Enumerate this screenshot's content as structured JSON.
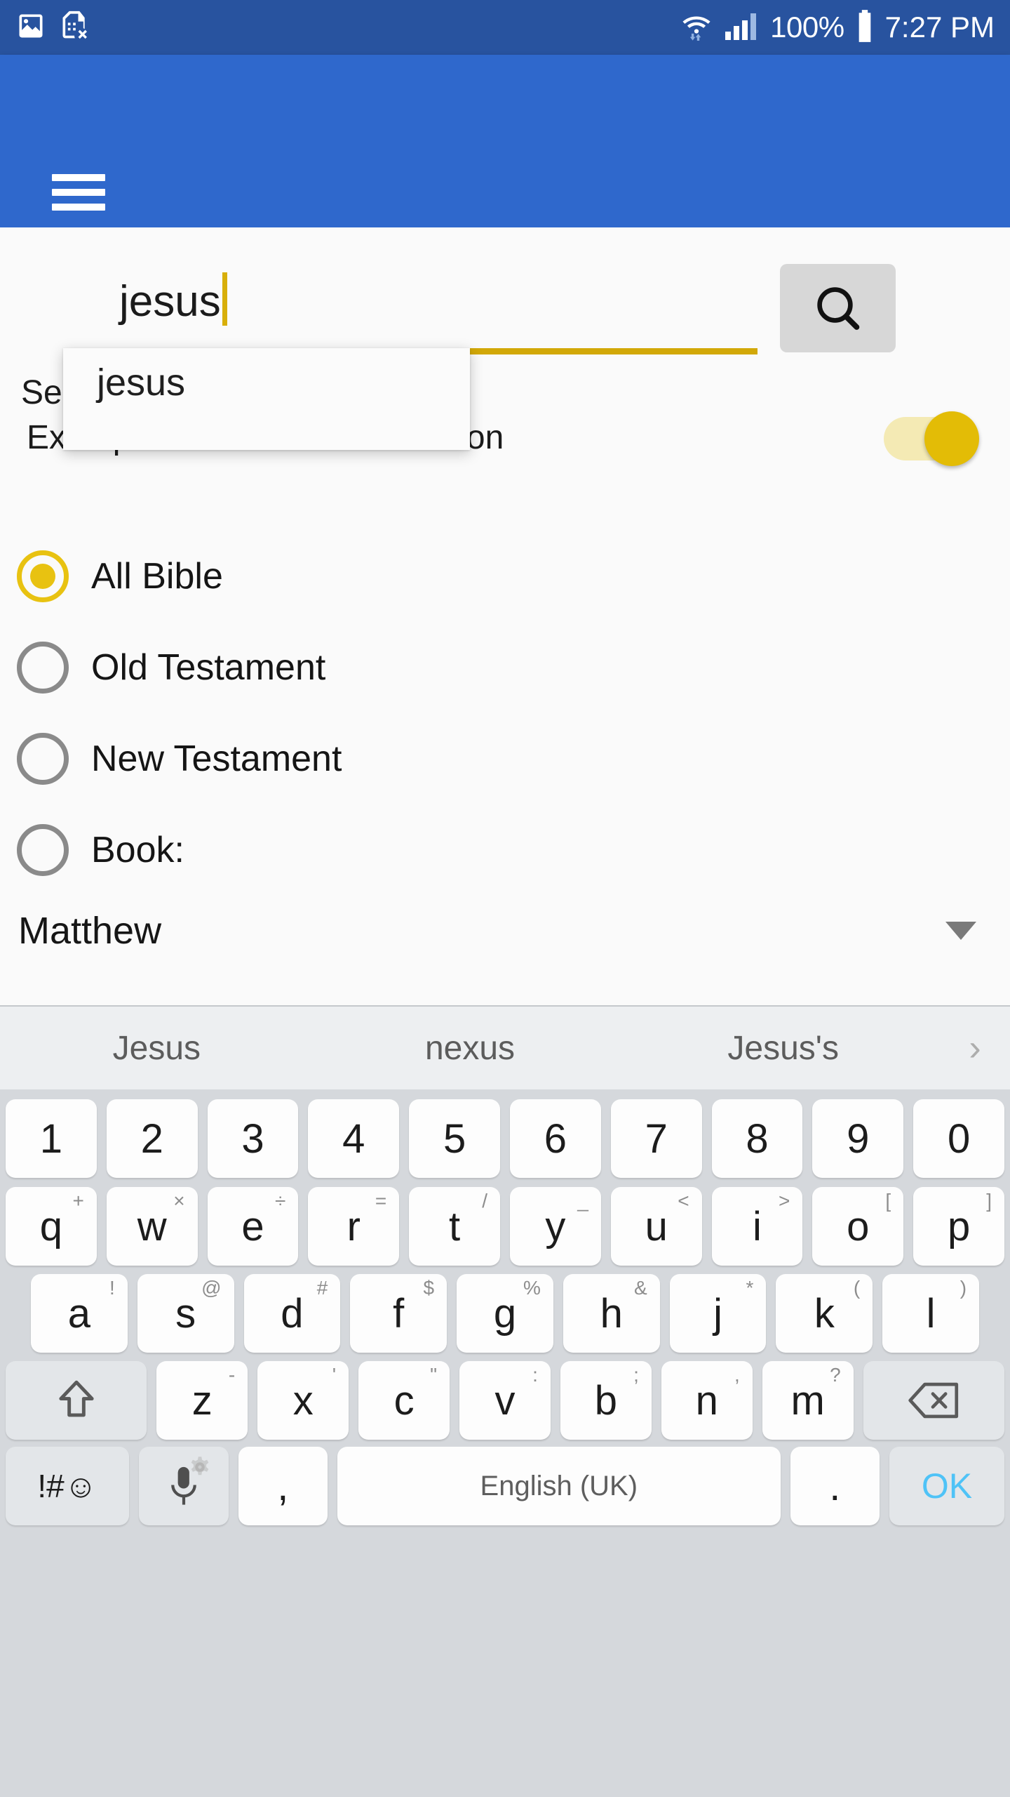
{
  "status_bar": {
    "left_icons": [
      "image-icon",
      "sim-card-error-icon"
    ],
    "wifi_icon": "wifi-icon",
    "signal_icon": "signal-bars-icon",
    "battery_percent": "100%",
    "battery_icon": "battery-full-icon",
    "time": "7:27 PM",
    "background_color": "#28539f"
  },
  "app_bar": {
    "menu_icon": "hamburger-menu-icon",
    "background_color": "#2f68cc"
  },
  "search": {
    "value": "jesus",
    "search_icon": "search-icon",
    "underline_color": "#d2a808",
    "suggestion_popup": {
      "items": [
        "jesus"
      ]
    },
    "hint_line1": "Search",
    "hint_line2": "Example: Resu for Resurrection",
    "toggle": {
      "name": "whole-word-toggle",
      "state": "on",
      "accent_color": "#e3bc06"
    }
  },
  "scope_options": [
    {
      "label": "All Bible",
      "selected": true
    },
    {
      "label": "Old Testament",
      "selected": false
    },
    {
      "label": "New Testament",
      "selected": false
    },
    {
      "label": "Book:",
      "selected": false
    }
  ],
  "book_spinner": {
    "value": "Matthew",
    "arrow_icon": "chevron-down-icon"
  },
  "keyboard": {
    "suggestions": [
      "Jesus",
      "nexus",
      "Jesus's"
    ],
    "more_icon": "chevron-right-icon",
    "row_numbers": [
      "1",
      "2",
      "3",
      "4",
      "5",
      "6",
      "7",
      "8",
      "9",
      "0"
    ],
    "row_top": [
      {
        "key": "q",
        "alt": "+"
      },
      {
        "key": "w",
        "alt": "×"
      },
      {
        "key": "e",
        "alt": "÷"
      },
      {
        "key": "r",
        "alt": "="
      },
      {
        "key": "t",
        "alt": "/"
      },
      {
        "key": "y",
        "alt": "_"
      },
      {
        "key": "u",
        "alt": "<"
      },
      {
        "key": "i",
        "alt": ">"
      },
      {
        "key": "o",
        "alt": "["
      },
      {
        "key": "p",
        "alt": "]"
      }
    ],
    "row_home": [
      {
        "key": "a",
        "alt": "!"
      },
      {
        "key": "s",
        "alt": "@"
      },
      {
        "key": "d",
        "alt": "#"
      },
      {
        "key": "f",
        "alt": "$"
      },
      {
        "key": "g",
        "alt": "%"
      },
      {
        "key": "h",
        "alt": "&"
      },
      {
        "key": "j",
        "alt": "*"
      },
      {
        "key": "k",
        "alt": "("
      },
      {
        "key": "l",
        "alt": ")"
      }
    ],
    "row_bottom": [
      {
        "key": "z",
        "alt": "-"
      },
      {
        "key": "x",
        "alt": "'"
      },
      {
        "key": "c",
        "alt": "\""
      },
      {
        "key": "v",
        "alt": ":"
      },
      {
        "key": "b",
        "alt": ";"
      },
      {
        "key": "n",
        "alt": ","
      },
      {
        "key": "m",
        "alt": "?"
      }
    ],
    "shift_icon": "shift-arrow-icon",
    "backspace_icon": "backspace-icon",
    "symbols_key": "!#☺",
    "mic_icon": "microphone-icon",
    "mic_settings_icon": "gear-icon",
    "comma_key": ",",
    "space_label": "English (UK)",
    "period_key": ".",
    "ok_key": "OK",
    "ok_color": "#4fc3f7"
  }
}
